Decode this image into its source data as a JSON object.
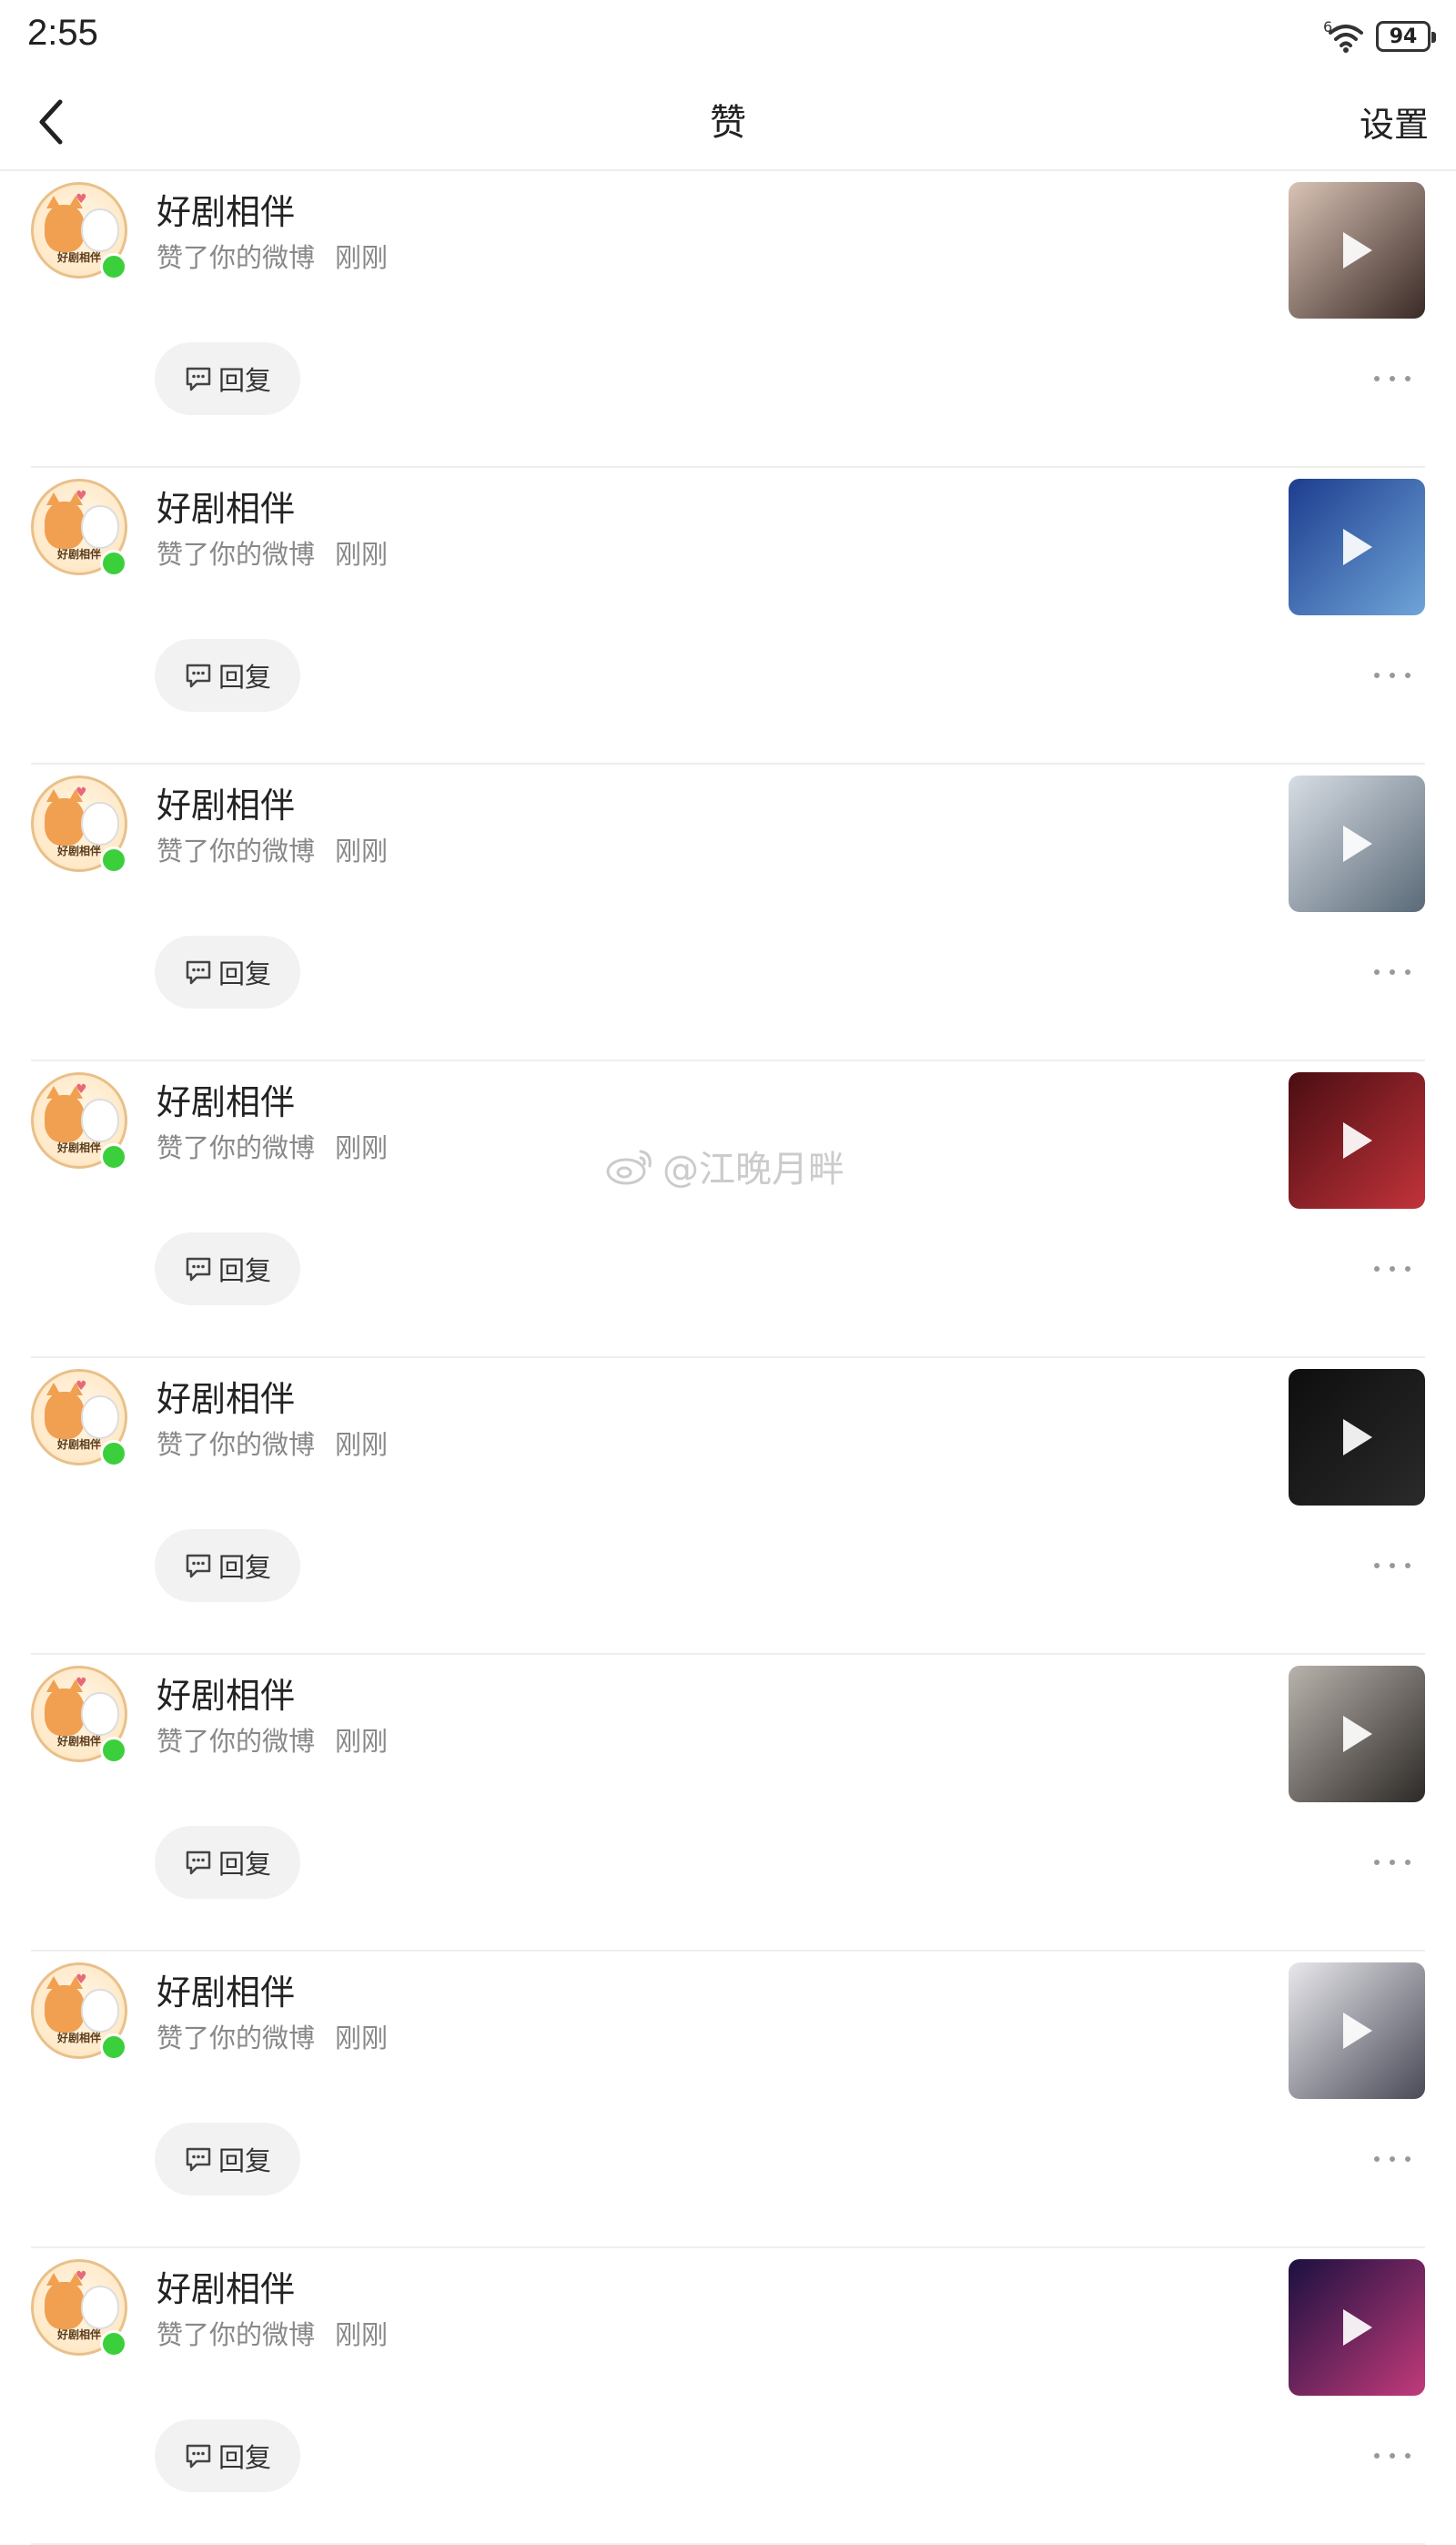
{
  "status_bar": {
    "time": "2:55",
    "network": "6",
    "battery": "94"
  },
  "header": {
    "title": "赞",
    "settings_label": "设置"
  },
  "watermark": "@江晚月畔",
  "items": [
    {
      "name": "好剧相伴",
      "action": "赞了你的微博",
      "time": "刚刚",
      "reply_label": "回复",
      "avatar_text": "好剧相伴",
      "thumb_colors": [
        "#d9c3b5",
        "#3a2a26"
      ]
    },
    {
      "name": "好剧相伴",
      "action": "赞了你的微博",
      "time": "刚刚",
      "reply_label": "回复",
      "avatar_text": "好剧相伴",
      "thumb_colors": [
        "#1d3d8f",
        "#6fa4d8"
      ]
    },
    {
      "name": "好剧相伴",
      "action": "赞了你的微博",
      "time": "刚刚",
      "reply_label": "回复",
      "avatar_text": "好剧相伴",
      "thumb_colors": [
        "#d8dde4",
        "#5a6a78"
      ]
    },
    {
      "name": "好剧相伴",
      "action": "赞了你的微博",
      "time": "刚刚",
      "reply_label": "回复",
      "avatar_text": "好剧相伴",
      "thumb_colors": [
        "#4a0d12",
        "#c2333a"
      ]
    },
    {
      "name": "好剧相伴",
      "action": "赞了你的微博",
      "time": "刚刚",
      "reply_label": "回复",
      "avatar_text": "好剧相伴",
      "thumb_colors": [
        "#0e0e0e",
        "#2a2a2a"
      ]
    },
    {
      "name": "好剧相伴",
      "action": "赞了你的微博",
      "time": "刚刚",
      "reply_label": "回复",
      "avatar_text": "好剧相伴",
      "thumb_colors": [
        "#b9b3ad",
        "#2d2926"
      ]
    },
    {
      "name": "好剧相伴",
      "action": "赞了你的微博",
      "time": "刚刚",
      "reply_label": "回复",
      "avatar_text": "好剧相伴",
      "thumb_colors": [
        "#e8e8ec",
        "#4a4a58"
      ]
    },
    {
      "name": "好剧相伴",
      "action": "赞了你的微博",
      "time": "刚刚",
      "reply_label": "回复",
      "avatar_text": "好剧相伴",
      "thumb_colors": [
        "#1a1040",
        "#c23a7a"
      ]
    }
  ]
}
